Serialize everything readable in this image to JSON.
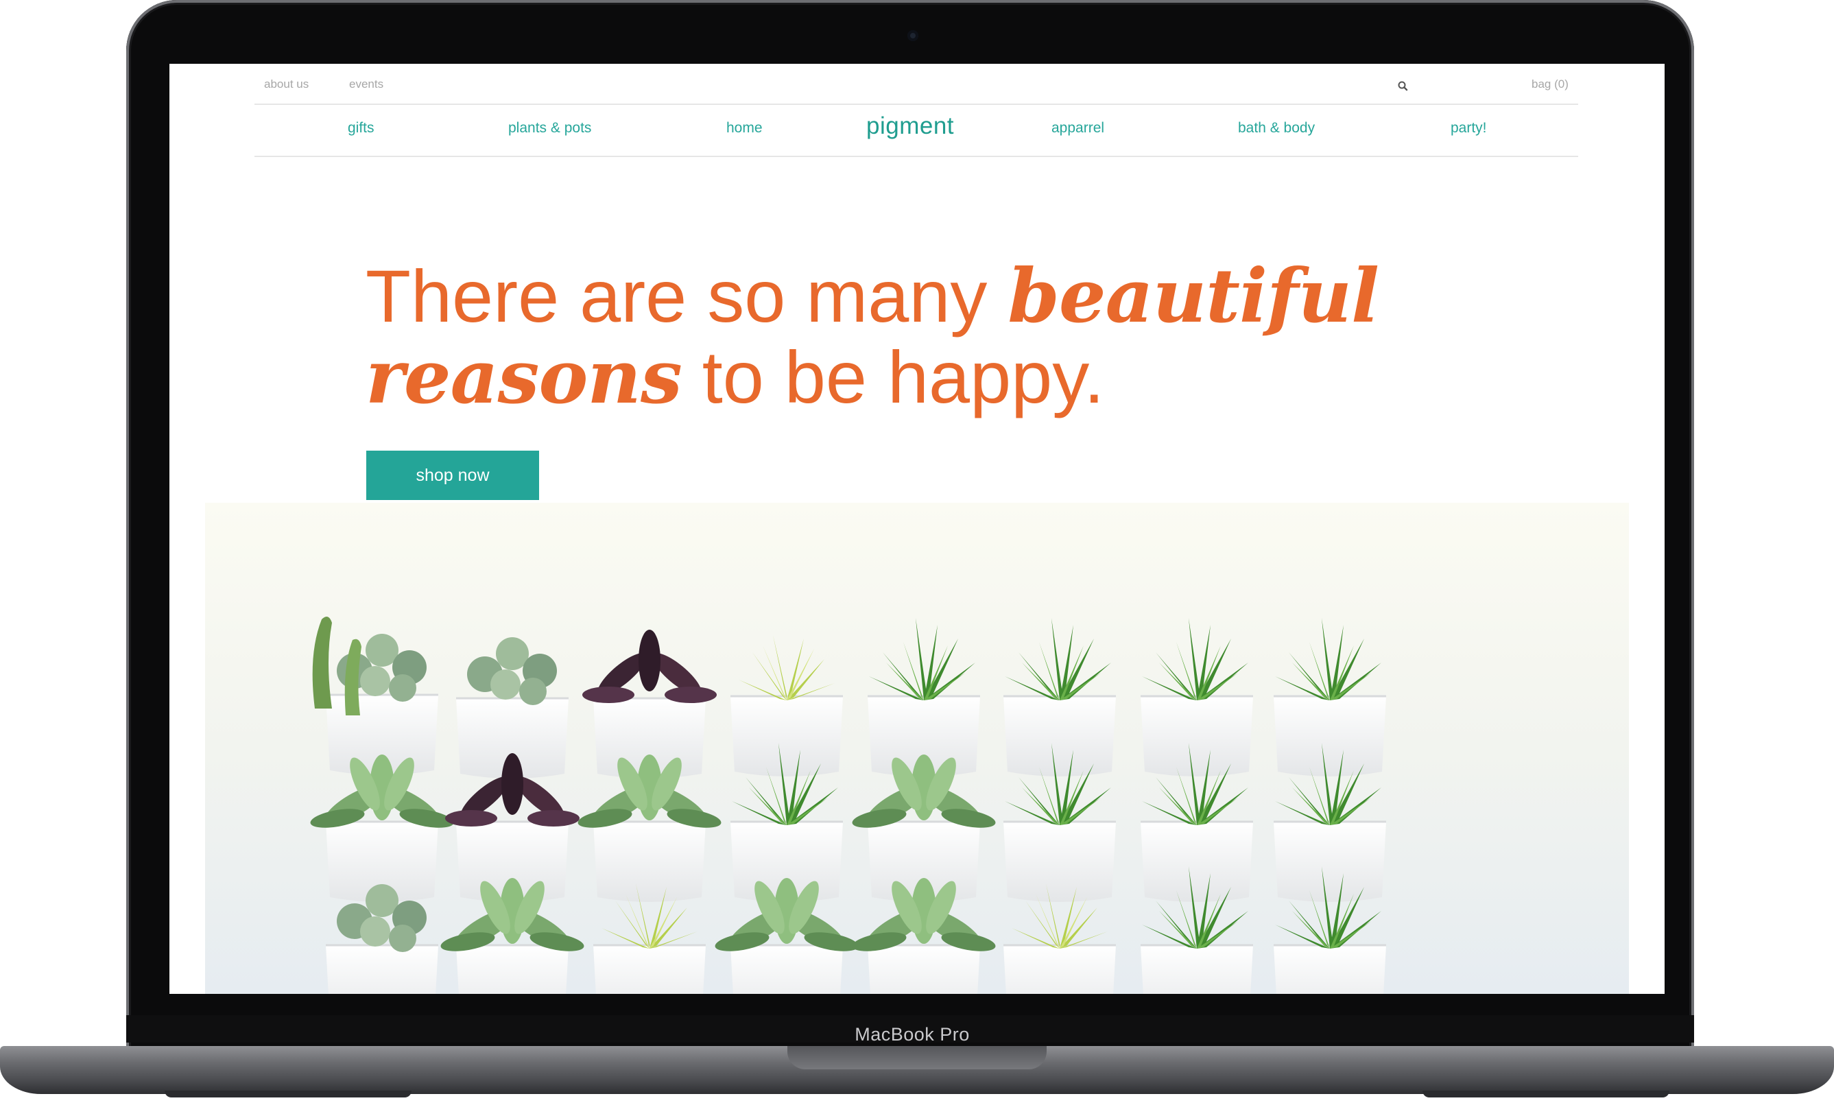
{
  "device": {
    "label": "MacBook Pro"
  },
  "site": {
    "utility_nav": {
      "about": "about us",
      "events": "events",
      "bag": "bag (0)"
    },
    "logo": "pigment",
    "nav": [
      "gifts",
      "plants & pots",
      "home",
      "apparrel",
      "bath & body",
      "party!"
    ],
    "hero": {
      "headline_part1": "There are so many ",
      "headline_bold1": "beautiful",
      "headline_bold2": "reasons",
      "headline_part2": " to be happy.",
      "cta": "shop now"
    },
    "colors": {
      "accent": "#24a598",
      "headline": "#e8692c",
      "muted": "#a7a7a7"
    }
  }
}
